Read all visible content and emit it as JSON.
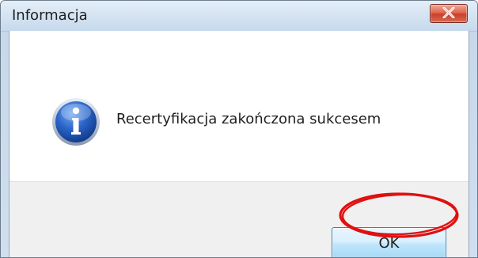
{
  "dialog": {
    "title": "Informacja",
    "message": "Recertyfikacja zakończona sukcesem",
    "ok_label": "OK"
  },
  "icons": {
    "title_close": "close-icon",
    "message_icon": "info-icon"
  },
  "colors": {
    "close_button": "#d9533b",
    "annotation": "#e01010",
    "ok_button_border": "#3c7fb1",
    "info_icon_blue": "#1e55b8"
  }
}
